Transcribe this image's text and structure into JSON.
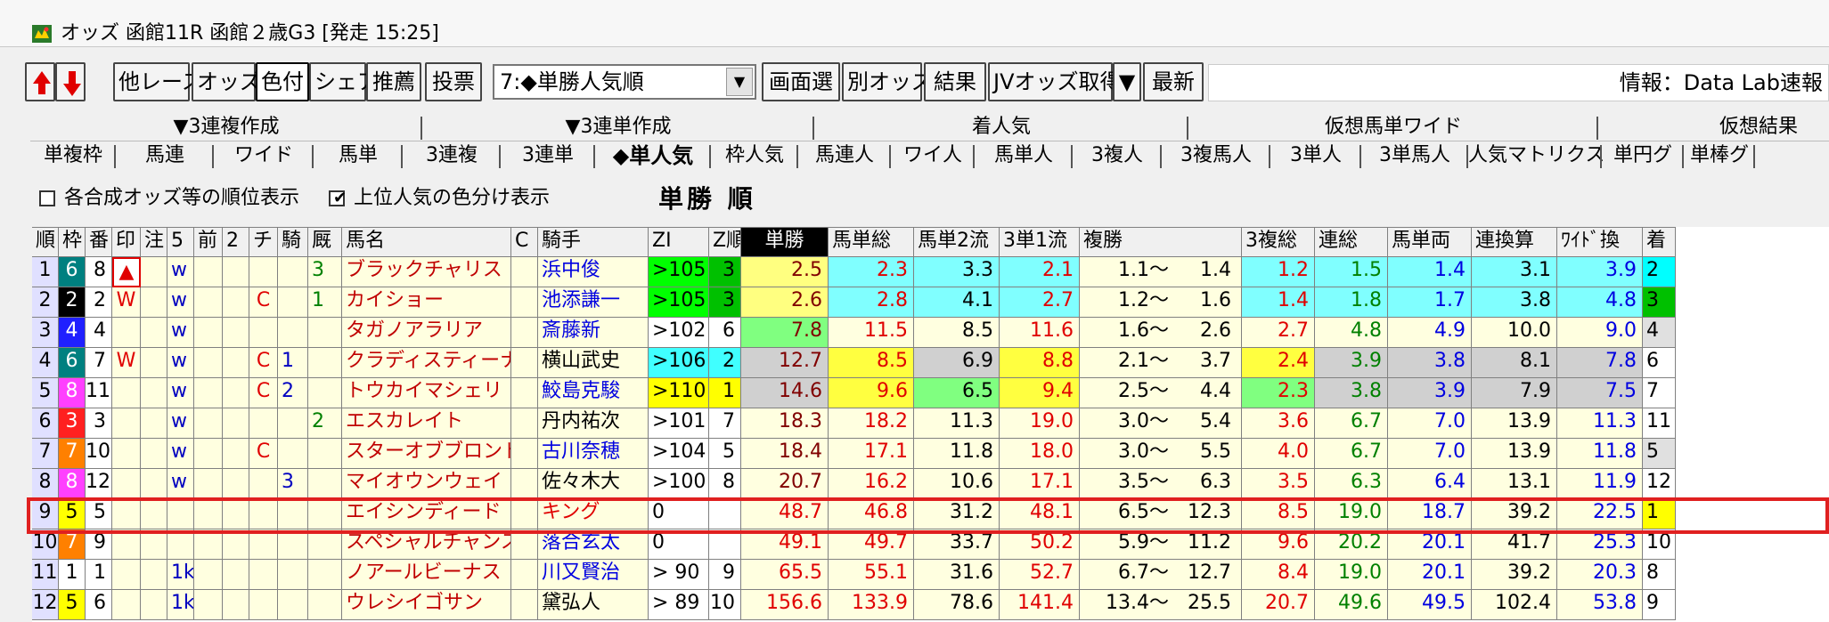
{
  "window": {
    "title": "オッズ 函館11R 函館２歳G3 [発走 15:25]"
  },
  "toolbar": {
    "other_race": "他レース",
    "odds": "オッズ",
    "color": "色付",
    "share": "シェア",
    "recommend": "推薦",
    "vote": "投票",
    "sort_select": "7:◆単勝人気順",
    "screen_select": "画面選",
    "other_odds": "別オッズ",
    "result": "結果",
    "jv_odds": "JVオッズ取得",
    "jv_arrow": "▼",
    "latest": "最新",
    "info": "情報：Data Lab速報"
  },
  "tabs_top": [
    {
      "label": "▼3連複作成"
    },
    {
      "label": "▼3連単作成"
    },
    {
      "label": "着人気"
    },
    {
      "label": "仮想馬単ワイド"
    },
    {
      "label": "仮想結果"
    }
  ],
  "tabs_bottom": [
    {
      "label": "単複枠"
    },
    {
      "label": "馬連"
    },
    {
      "label": "ワイド"
    },
    {
      "label": "馬単"
    },
    {
      "label": "3連複"
    },
    {
      "label": "3連単"
    },
    {
      "label": "◆単人気"
    },
    {
      "label": "枠人気"
    },
    {
      "label": "馬連人"
    },
    {
      "label": "ワイ人"
    },
    {
      "label": "馬単人"
    },
    {
      "label": "3複人"
    },
    {
      "label": "3複馬人"
    },
    {
      "label": "3単人"
    },
    {
      "label": "3単馬人"
    },
    {
      "label": "人気マトリクス"
    },
    {
      "label": "単円グ"
    },
    {
      "label": "単棒グ"
    }
  ],
  "options": {
    "opt1_label": "各合成オッズ等の順位表示",
    "opt1_checked": false,
    "opt2_label": "上位人気の色分け表示",
    "opt2_checked": true,
    "mark_checked": "✔",
    "view_title": "単勝 順"
  },
  "table": {
    "headers": [
      "順",
      "枠",
      "番",
      "印",
      "注",
      "5",
      "前",
      "2",
      "チ",
      "騎",
      "厩",
      "馬名",
      "C",
      "騎手",
      "ZI",
      "Z順",
      "単勝",
      "馬単総",
      "馬単2流",
      "3単1流",
      "複勝",
      "3複総",
      "連総",
      "馬単両",
      "連換算",
      "ﾜｲﾄﾞ換",
      "着"
    ],
    "rows": [
      {
        "rank": "1",
        "waku": "6",
        "ban": "8",
        "mark": "▲",
        "note": "",
        "five": "w",
        "mae": "",
        "two": "",
        "chi": "",
        "ki": "",
        "kyu": "3",
        "name": "ブラックチャリス",
        "c": "",
        "jockey": "浜中俊",
        "zi": ">105",
        "zr": "3",
        "tan": "2.5",
        "bt": "2.3",
        "b2": "3.3",
        "s1": "2.1",
        "fuku_lo": "1.1〜",
        "fuku_hi": "1.4",
        "f3": "1.2",
        "ren": "1.5",
        "bw": "1.4",
        "rk": "3.1",
        "wd": "3.9",
        "chaku": "2"
      },
      {
        "rank": "2",
        "waku": "2",
        "ban": "2",
        "mark": "W",
        "note": "",
        "five": "w",
        "mae": "",
        "two": "",
        "chi": "C",
        "ki": "",
        "kyu": "1",
        "name": "カイショー",
        "c": "",
        "jockey": "池添謙一",
        "zi": ">105",
        "zr": "3",
        "tan": "2.6",
        "bt": "2.8",
        "b2": "4.1",
        "s1": "2.7",
        "fuku_lo": "1.2〜",
        "fuku_hi": "1.6",
        "f3": "1.4",
        "ren": "1.8",
        "bw": "1.7",
        "rk": "3.8",
        "wd": "4.8",
        "chaku": "3"
      },
      {
        "rank": "3",
        "waku": "4",
        "ban": "4",
        "mark": "",
        "note": "",
        "five": "w",
        "mae": "",
        "two": "",
        "chi": "",
        "ki": "",
        "kyu": "",
        "name": "タガノアラリア",
        "c": "",
        "jockey": "斎藤新",
        "zi": ">102",
        "zr": "6",
        "tan": "7.8",
        "bt": "11.5",
        "b2": "8.5",
        "s1": "11.6",
        "fuku_lo": "1.6〜",
        "fuku_hi": "2.6",
        "f3": "2.7",
        "ren": "4.8",
        "bw": "4.9",
        "rk": "10.0",
        "wd": "9.0",
        "chaku": "4"
      },
      {
        "rank": "4",
        "waku": "6",
        "ban": "7",
        "mark": "W",
        "note": "",
        "five": "w",
        "mae": "",
        "two": "",
        "chi": "C",
        "ki": "1",
        "kyu": "",
        "name": "クラディスティーナ",
        "c": "",
        "jockey": "横山武史",
        "zi": ">106",
        "zr": "2",
        "tan": "12.7",
        "bt": "8.5",
        "b2": "6.9",
        "s1": "8.8",
        "fuku_lo": "2.1〜",
        "fuku_hi": "3.7",
        "f3": "2.4",
        "ren": "3.9",
        "bw": "3.8",
        "rk": "8.1",
        "wd": "7.8",
        "chaku": "6"
      },
      {
        "rank": "5",
        "waku": "8",
        "ban": "11",
        "mark": "",
        "note": "",
        "five": "w",
        "mae": "",
        "two": "",
        "chi": "C",
        "ki": "2",
        "kyu": "",
        "name": "トウカイマシェリ",
        "c": "",
        "jockey": "鮫島克駿",
        "zi": ">110",
        "zr": "1",
        "tan": "14.6",
        "bt": "9.6",
        "b2": "6.5",
        "s1": "9.4",
        "fuku_lo": "2.5〜",
        "fuku_hi": "4.4",
        "f3": "2.3",
        "ren": "3.8",
        "bw": "3.9",
        "rk": "7.9",
        "wd": "7.5",
        "chaku": "7"
      },
      {
        "rank": "6",
        "waku": "3",
        "ban": "3",
        "mark": "",
        "note": "",
        "five": "w",
        "mae": "",
        "two": "",
        "chi": "",
        "ki": "",
        "kyu": "2",
        "name": "エスカレイト",
        "c": "",
        "jockey": "丹内祐次",
        "zi": ">101",
        "zr": "7",
        "tan": "18.3",
        "bt": "18.2",
        "b2": "11.3",
        "s1": "19.0",
        "fuku_lo": "3.0〜",
        "fuku_hi": "5.4",
        "f3": "3.6",
        "ren": "6.7",
        "bw": "7.0",
        "rk": "13.9",
        "wd": "11.3",
        "chaku": "11"
      },
      {
        "rank": "7",
        "waku": "7",
        "ban": "10",
        "mark": "",
        "note": "",
        "five": "w",
        "mae": "",
        "two": "",
        "chi": "C",
        "ki": "",
        "kyu": "",
        "name": "スターオブブロンドン",
        "c": "",
        "jockey": "古川奈穂",
        "zi": ">104",
        "zr": "5",
        "tan": "18.4",
        "bt": "17.1",
        "b2": "11.8",
        "s1": "18.0",
        "fuku_lo": "3.0〜",
        "fuku_hi": "5.5",
        "f3": "4.0",
        "ren": "6.7",
        "bw": "7.0",
        "rk": "13.9",
        "wd": "11.8",
        "chaku": "5"
      },
      {
        "rank": "8",
        "waku": "8",
        "ban": "12",
        "mark": "",
        "note": "",
        "five": "w",
        "mae": "",
        "two": "",
        "chi": "",
        "ki": "3",
        "kyu": "",
        "name": "マイオウンウェイ",
        "c": "",
        "jockey": "佐々木大",
        "zi": ">100",
        "zr": "8",
        "tan": "20.7",
        "bt": "16.2",
        "b2": "10.6",
        "s1": "17.1",
        "fuku_lo": "3.5〜",
        "fuku_hi": "6.3",
        "f3": "3.5",
        "ren": "6.3",
        "bw": "6.4",
        "rk": "13.1",
        "wd": "11.9",
        "chaku": "12"
      },
      {
        "rank": "9",
        "waku": "5",
        "ban": "5",
        "mark": "",
        "note": "",
        "five": "",
        "mae": "",
        "two": "",
        "chi": "",
        "ki": "",
        "kyu": "",
        "name": "エイシンディード",
        "c": "",
        "jockey": "キング",
        "zi": "0",
        "zr": "",
        "tan": "48.7",
        "bt": "46.8",
        "b2": "31.2",
        "s1": "48.1",
        "fuku_lo": "6.5〜",
        "fuku_hi": "12.3",
        "f3": "8.5",
        "ren": "19.0",
        "bw": "18.7",
        "rk": "39.2",
        "wd": "22.5",
        "chaku": "1"
      },
      {
        "rank": "10",
        "waku": "7",
        "ban": "9",
        "mark": "",
        "note": "",
        "five": "",
        "mae": "",
        "two": "",
        "chi": "",
        "ki": "",
        "kyu": "",
        "name": "スペシャルチャンス",
        "c": "",
        "jockey": "落合玄太",
        "zi": "0",
        "zr": "",
        "tan": "49.1",
        "bt": "49.7",
        "b2": "33.7",
        "s1": "50.2",
        "fuku_lo": "5.9〜",
        "fuku_hi": "11.2",
        "f3": "9.6",
        "ren": "20.2",
        "bw": "20.1",
        "rk": "41.7",
        "wd": "25.3",
        "chaku": "10"
      },
      {
        "rank": "11",
        "waku": "1",
        "ban": "1",
        "mark": "",
        "note": "",
        "five": "1k",
        "mae": "",
        "two": "",
        "chi": "",
        "ki": "",
        "kyu": "",
        "name": "ノアールビーナス",
        "c": "",
        "jockey": "川又賢治",
        "zi": "> 90",
        "zr": "9",
        "tan": "65.5",
        "bt": "55.1",
        "b2": "31.6",
        "s1": "52.7",
        "fuku_lo": "6.7〜",
        "fuku_hi": "12.7",
        "f3": "8.4",
        "ren": "19.0",
        "bw": "20.1",
        "rk": "39.2",
        "wd": "20.3",
        "chaku": "8"
      },
      {
        "rank": "12",
        "waku": "5",
        "ban": "6",
        "mark": "",
        "note": "",
        "five": "1k",
        "mae": "",
        "two": "",
        "chi": "",
        "ki": "",
        "kyu": "",
        "name": "ウレシイゴサン",
        "c": "",
        "jockey": "黛弘人",
        "zi": "> 89",
        "zr": "10",
        "tan": "156.6",
        "bt": "133.9",
        "b2": "78.6",
        "s1": "141.4",
        "fuku_lo": "13.4〜",
        "fuku_hi": "25.5",
        "f3": "20.7",
        "ren": "49.6",
        "bw": "49.5",
        "rk": "102.4",
        "wd": "53.8",
        "chaku": "9"
      }
    ]
  },
  "colors": {
    "waku": {
      "1": "#ffffff",
      "2": "#000000",
      "3": "#ff2020",
      "4": "#2020ff",
      "5": "#ffff00",
      "6": "#008080",
      "7": "#ff8000",
      "8": "#ff40ff"
    },
    "rank1": "#80ffff",
    "rank2": "#80ffff",
    "rank3": "#80ff80",
    "rank4": "#c0c0c0",
    "row_bg": "#ffffe0",
    "chaku1": "#ffff00",
    "chaku2": "#00ffff",
    "chaku3": "#00c000",
    "highlight": "#e02020"
  }
}
